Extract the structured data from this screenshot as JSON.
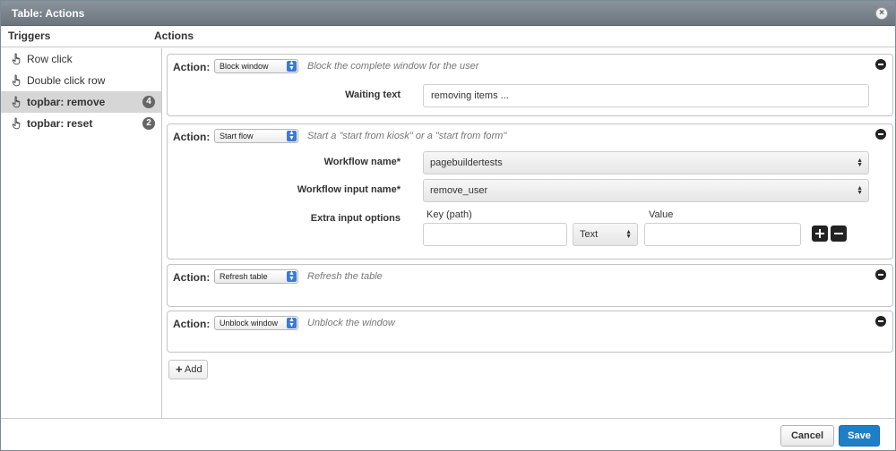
{
  "window": {
    "title": "Table: Actions"
  },
  "headers": {
    "triggers": "Triggers",
    "actions": "Actions"
  },
  "triggers": [
    {
      "label": "Row click",
      "badge": "",
      "active": false
    },
    {
      "label": "Double click row",
      "badge": "",
      "active": false
    },
    {
      "label": "topbar: remove",
      "badge": "4",
      "active": true
    },
    {
      "label": "topbar: reset",
      "badge": "2",
      "active": false
    }
  ],
  "actions": [
    {
      "label": "Action:",
      "type": "Block window",
      "description": "Block the complete window for the user",
      "fields": {
        "waiting_text_label": "Waiting text",
        "waiting_text_value": "removing items ..."
      }
    },
    {
      "label": "Action:",
      "type": "Start flow",
      "description": "Start a \"start from kiosk\" or a \"start from form\"",
      "fields": {
        "workflow_name_label": "Workflow name*",
        "workflow_name_value": "pagebuildertests",
        "workflow_input_label": "Workflow input name*",
        "workflow_input_value": "remove_user",
        "extra_options_label": "Extra input options",
        "key_header": "Key (path)",
        "value_header": "Value",
        "key_value": "",
        "type_value": "Text",
        "value_value": ""
      }
    },
    {
      "label": "Action:",
      "type": "Refresh table",
      "description": "Refresh the table"
    },
    {
      "label": "Action:",
      "type": "Unblock window",
      "description": "Unblock the window"
    }
  ],
  "add_button": "Add",
  "footer": {
    "cancel": "Cancel",
    "save": "Save"
  },
  "colors": {
    "titlebar": "#7a828a",
    "active_trigger": "#d6d6d6",
    "badge": "#666666",
    "select_arrow": "#3a7bd5",
    "save_button": "#1f7fc6"
  },
  "icons": {
    "trigger": "hand-pointer-icon",
    "close": "close-circle-icon",
    "remove": "minus-circle-icon",
    "add_row": "plus-square-icon",
    "remove_row": "minus-square-icon"
  }
}
